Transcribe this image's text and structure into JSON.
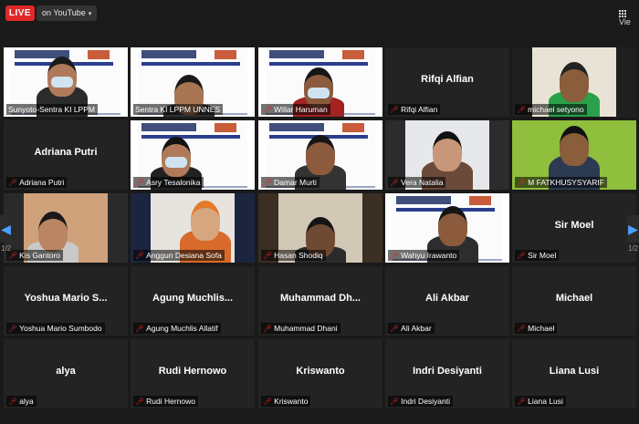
{
  "topbar": {
    "live_label": "LIVE",
    "stream_label": "on YouTube",
    "view_label": "Vie"
  },
  "pagination": {
    "left_page": "1/2",
    "right_page": "1/2"
  },
  "colors": {
    "live_red": "#e02828",
    "active_speaker_border": "#e9d84a",
    "nav_arrow_blue": "#4aa3ff",
    "tile_background": "#232323"
  },
  "participants": [
    {
      "display": "",
      "label": "Sunyoto-Sentra KI LPPM",
      "video": true,
      "active": true,
      "muted": false
    },
    {
      "display": "",
      "label": "Sentra KI LPPM UNNES",
      "video": true,
      "muted": false
    },
    {
      "display": "",
      "label": "Willar Haruman",
      "video": true,
      "muted": true
    },
    {
      "display": "Rifqi Alfian",
      "label": "Rifqi Alfian",
      "video": false,
      "muted": true
    },
    {
      "display": "",
      "label": "michael setyono",
      "video": true,
      "muted": true
    },
    {
      "display": "Adriana Putri",
      "label": "Adriana Putri",
      "video": false,
      "muted": true
    },
    {
      "display": "",
      "label": "Asry Tesalonika",
      "video": true,
      "muted": true
    },
    {
      "display": "",
      "label": "Damar Murti",
      "video": true,
      "muted": true
    },
    {
      "display": "",
      "label": "Vera Natalia",
      "video": true,
      "muted": true
    },
    {
      "display": "",
      "label": "M FATKHUSYSYARIF",
      "video": true,
      "muted": true
    },
    {
      "display": "",
      "label": "Kis Gantoro",
      "video": true,
      "muted": true
    },
    {
      "display": "",
      "label": "Anggun Desiana Sofa",
      "video": true,
      "muted": true
    },
    {
      "display": "",
      "label": "Hasan Shodiq",
      "video": true,
      "muted": true
    },
    {
      "display": "",
      "label": "Wahyu Irawanto",
      "video": true,
      "muted": true
    },
    {
      "display": "Sir Moel",
      "label": "Sir Moel",
      "video": false,
      "muted": true
    },
    {
      "display": "Yoshua Mario S...",
      "label": "Yoshua Mario Sumbodo",
      "video": false,
      "muted": true
    },
    {
      "display": "Agung Muchlis...",
      "label": "Agung Muchlis Allatif",
      "video": false,
      "muted": true
    },
    {
      "display": "Muhammad Dh...",
      "label": "Muhammad Dhani",
      "video": false,
      "muted": true
    },
    {
      "display": "Ali Akbar",
      "label": "Ali Akbar",
      "video": false,
      "muted": true
    },
    {
      "display": "Michael",
      "label": "Michael",
      "video": false,
      "muted": true
    },
    {
      "display": "alya",
      "label": "alya",
      "video": false,
      "muted": true
    },
    {
      "display": "Rudi Hernowo",
      "label": "Rudi Hernowo",
      "video": false,
      "muted": true
    },
    {
      "display": "Kriswanto",
      "label": "Kriswanto",
      "video": false,
      "muted": true
    },
    {
      "display": "Indri Desiyanti",
      "label": "Indri Desiyanti",
      "video": false,
      "muted": true
    },
    {
      "display": "Liana Lusi",
      "label": "Liana Lusi",
      "video": false,
      "muted": true
    }
  ]
}
